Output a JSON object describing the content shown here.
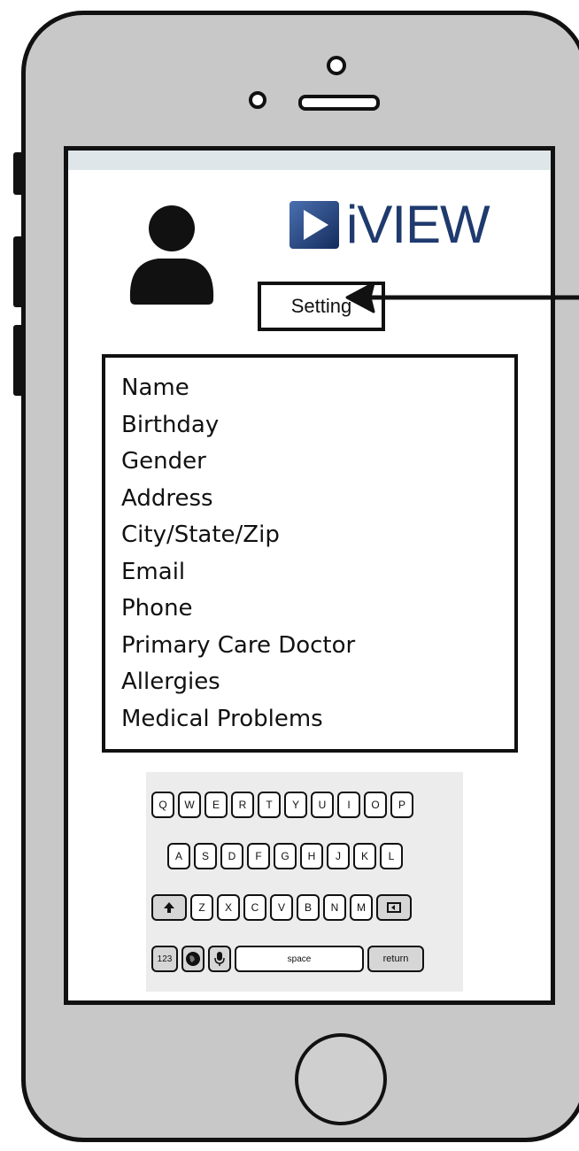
{
  "header": {
    "logo_text": "iVIEW",
    "settings_label": "Setting"
  },
  "profile": {
    "fields": [
      "Name",
      "Birthday",
      "Gender",
      "Address",
      "City/State/Zip",
      "Email",
      "Phone",
      "Primary Care Doctor",
      "Allergies",
      "Medical Problems"
    ]
  },
  "keyboard": {
    "row1": [
      "Q",
      "W",
      "E",
      "R",
      "T",
      "Y",
      "U",
      "I",
      "O",
      "P"
    ],
    "row2": [
      "A",
      "S",
      "D",
      "F",
      "G",
      "H",
      "J",
      "K",
      "L"
    ],
    "row3": [
      "Z",
      "X",
      "C",
      "V",
      "B",
      "N",
      "M"
    ],
    "num_label": "123",
    "space_label": "space",
    "return_label": "return"
  },
  "icons": {
    "avatar": "user-silhouette-icon",
    "logo": "play-logo-icon",
    "shift": "shift-arrow-icon",
    "backspace": "backspace-icon",
    "globe": "globe-icon",
    "mic": "microphone-icon"
  },
  "colors": {
    "logo_blue": "#1f3a6e",
    "device_gray": "#c8c8c8",
    "status_bar": "#dfe6ea"
  }
}
